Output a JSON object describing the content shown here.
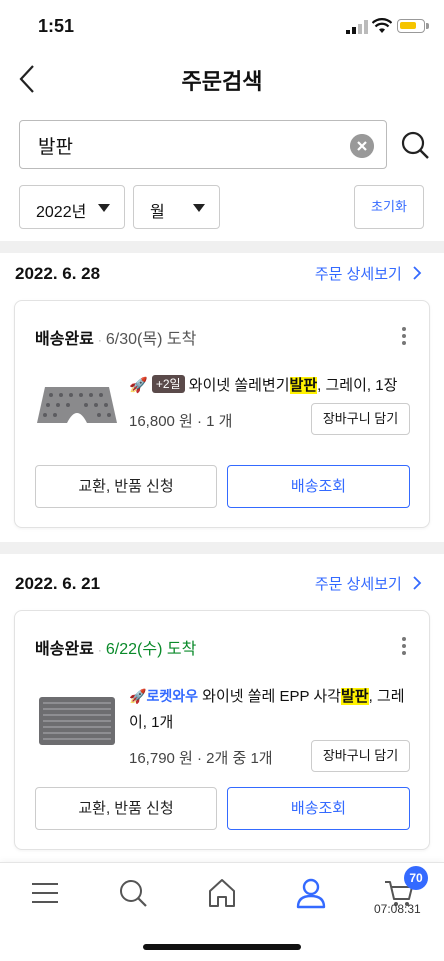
{
  "status_bar": {
    "time": "1:51"
  },
  "header": {
    "title": "주문검색"
  },
  "search": {
    "query": "발판",
    "placeholder": ""
  },
  "filters": {
    "year": "2022년",
    "month": "월",
    "reset_label": "초기화"
  },
  "orders": [
    {
      "date": "2022. 6. 28",
      "detail_label": "주문 상세보기",
      "status": "배송완료",
      "arrival": "6/30(목) 도착",
      "arrival_color": "#555555",
      "badge": "+2일",
      "name_prefix": "와이넷 쏠레변기",
      "name_highlight": "발판",
      "name_suffix": ", 그레이, 1장",
      "price": "16,800 원 · 1 개",
      "cart_label": "장바구니 담기",
      "exchange_label": "교환, 반품 신청",
      "tracking_label": "배송조회"
    },
    {
      "date": "2022. 6. 21",
      "detail_label": "주문 상세보기",
      "status": "배송완료",
      "arrival": "6/22(수) 도착",
      "arrival_color": "#0a8a2a",
      "rocket_label": "로켓와우",
      "name_prefix": "와이넷 쏠레 EPP 사각",
      "name_highlight": "발판",
      "name_suffix": ", 그레이, 1개",
      "price": "16,790 원 · 2개 중 1개",
      "cart_label": "장바구니 담기",
      "exchange_label": "교환, 반품 신청",
      "tracking_label": "배송조회"
    }
  ],
  "tabbar": {
    "items": [
      "menu-icon",
      "search-icon",
      "home-icon",
      "my-account-icon",
      "cart-icon"
    ],
    "active": "my-account-icon",
    "cart_count": "70",
    "clock": "07:08:31"
  },
  "colors": {
    "accent": "#346aff",
    "highlight": "#fff200",
    "badge_bg": "#5a4a4a",
    "green": "#0a8a2a"
  }
}
